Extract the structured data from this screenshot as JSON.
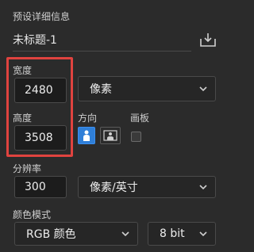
{
  "panel": {
    "section_title": "预设详细信息",
    "document_name": "未标题-1",
    "save_icon": "save-preset-icon"
  },
  "size": {
    "width_label": "宽度",
    "width_value": "2480",
    "unit_selected": "像素",
    "height_label": "高度",
    "height_value": "3508",
    "orientation_label": "方向",
    "artboard_label": "画板",
    "artboard_checked": false
  },
  "resolution": {
    "label": "分辨率",
    "value": "300",
    "unit_selected": "像素/英寸"
  },
  "color_mode": {
    "label": "颜色模式",
    "mode_selected": "RGB 颜色",
    "bit_selected": "8 bit"
  },
  "colors": {
    "highlight": "#e0433f",
    "accent": "#2f7fd8",
    "background": "#2b2b2b"
  }
}
